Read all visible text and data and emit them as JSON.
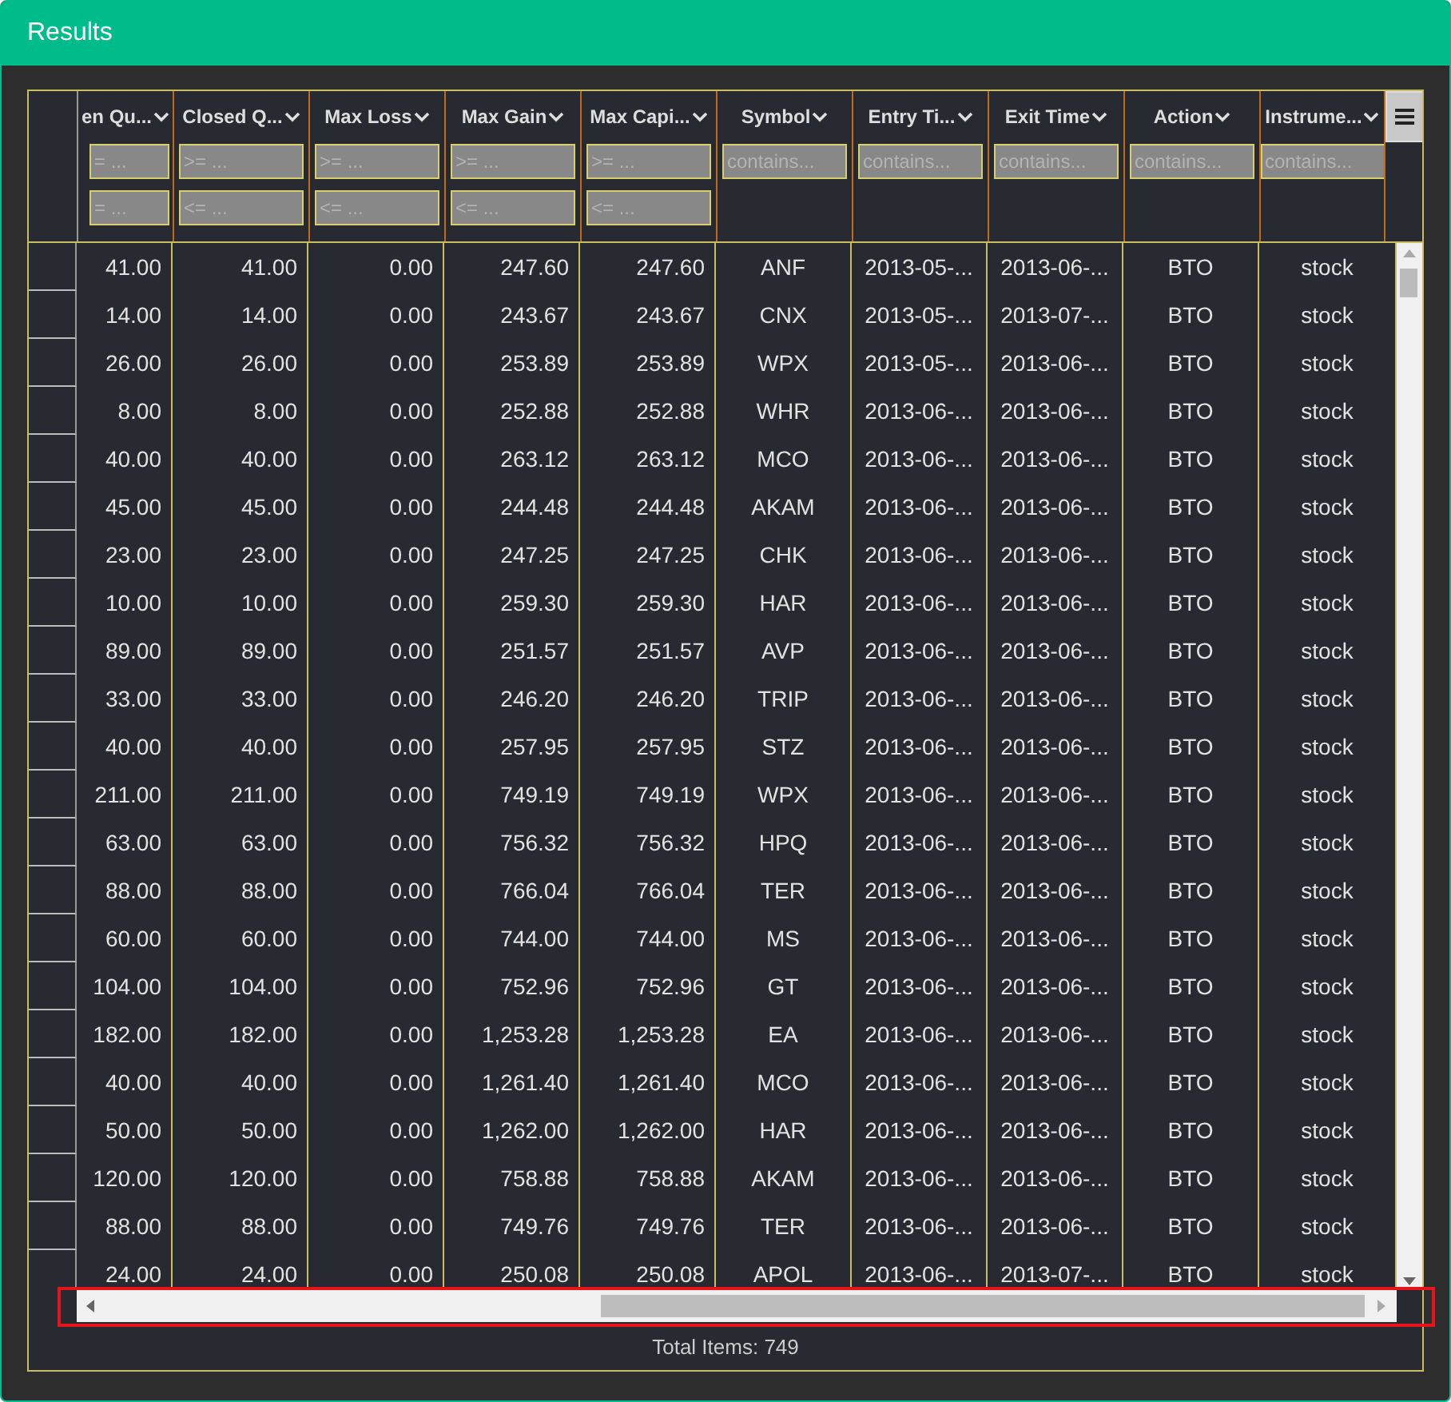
{
  "window": {
    "title": "Results"
  },
  "table": {
    "columns": [
      {
        "label": "en Qu...",
        "kind": "number",
        "placeholders": [
          "= ...",
          "= ..."
        ]
      },
      {
        "label": "Closed Q...",
        "kind": "number",
        "placeholders": [
          ">= ...",
          "<= ..."
        ]
      },
      {
        "label": "Max Loss",
        "kind": "number",
        "placeholders": [
          ">= ...",
          "<= ..."
        ]
      },
      {
        "label": "Max Gain",
        "kind": "number",
        "placeholders": [
          ">= ...",
          "<= ..."
        ]
      },
      {
        "label": "Max Capi...",
        "kind": "number",
        "placeholders": [
          ">= ...",
          "<= ..."
        ]
      },
      {
        "label": "Symbol",
        "kind": "text",
        "placeholders": [
          "contains..."
        ]
      },
      {
        "label": "Entry Ti...",
        "kind": "text",
        "placeholders": [
          "contains..."
        ]
      },
      {
        "label": "Exit Time",
        "kind": "text",
        "placeholders": [
          "contains..."
        ]
      },
      {
        "label": "Action",
        "kind": "text",
        "placeholders": [
          "contains..."
        ]
      },
      {
        "label": "Instrume...",
        "kind": "text",
        "placeholders": [
          "contains..."
        ]
      }
    ],
    "rows": [
      [
        "41.00",
        "41.00",
        "0.00",
        "247.60",
        "247.60",
        "ANF",
        "2013-05-...",
        "2013-06-...",
        "BTO",
        "stock"
      ],
      [
        "14.00",
        "14.00",
        "0.00",
        "243.67",
        "243.67",
        "CNX",
        "2013-05-...",
        "2013-07-...",
        "BTO",
        "stock"
      ],
      [
        "26.00",
        "26.00",
        "0.00",
        "253.89",
        "253.89",
        "WPX",
        "2013-05-...",
        "2013-06-...",
        "BTO",
        "stock"
      ],
      [
        "8.00",
        "8.00",
        "0.00",
        "252.88",
        "252.88",
        "WHR",
        "2013-06-...",
        "2013-06-...",
        "BTO",
        "stock"
      ],
      [
        "40.00",
        "40.00",
        "0.00",
        "263.12",
        "263.12",
        "MCO",
        "2013-06-...",
        "2013-06-...",
        "BTO",
        "stock"
      ],
      [
        "45.00",
        "45.00",
        "0.00",
        "244.48",
        "244.48",
        "AKAM",
        "2013-06-...",
        "2013-06-...",
        "BTO",
        "stock"
      ],
      [
        "23.00",
        "23.00",
        "0.00",
        "247.25",
        "247.25",
        "CHK",
        "2013-06-...",
        "2013-06-...",
        "BTO",
        "stock"
      ],
      [
        "10.00",
        "10.00",
        "0.00",
        "259.30",
        "259.30",
        "HAR",
        "2013-06-...",
        "2013-06-...",
        "BTO",
        "stock"
      ],
      [
        "89.00",
        "89.00",
        "0.00",
        "251.57",
        "251.57",
        "AVP",
        "2013-06-...",
        "2013-06-...",
        "BTO",
        "stock"
      ],
      [
        "33.00",
        "33.00",
        "0.00",
        "246.20",
        "246.20",
        "TRIP",
        "2013-06-...",
        "2013-06-...",
        "BTO",
        "stock"
      ],
      [
        "40.00",
        "40.00",
        "0.00",
        "257.95",
        "257.95",
        "STZ",
        "2013-06-...",
        "2013-06-...",
        "BTO",
        "stock"
      ],
      [
        "211.00",
        "211.00",
        "0.00",
        "749.19",
        "749.19",
        "WPX",
        "2013-06-...",
        "2013-06-...",
        "BTO",
        "stock"
      ],
      [
        "63.00",
        "63.00",
        "0.00",
        "756.32",
        "756.32",
        "HPQ",
        "2013-06-...",
        "2013-06-...",
        "BTO",
        "stock"
      ],
      [
        "88.00",
        "88.00",
        "0.00",
        "766.04",
        "766.04",
        "TER",
        "2013-06-...",
        "2013-06-...",
        "BTO",
        "stock"
      ],
      [
        "60.00",
        "60.00",
        "0.00",
        "744.00",
        "744.00",
        "MS",
        "2013-06-...",
        "2013-06-...",
        "BTO",
        "stock"
      ],
      [
        "104.00",
        "104.00",
        "0.00",
        "752.96",
        "752.96",
        "GT",
        "2013-06-...",
        "2013-06-...",
        "BTO",
        "stock"
      ],
      [
        "182.00",
        "182.00",
        "0.00",
        "1,253.28",
        "1,253.28",
        "EA",
        "2013-06-...",
        "2013-06-...",
        "BTO",
        "stock"
      ],
      [
        "40.00",
        "40.00",
        "0.00",
        "1,261.40",
        "1,261.40",
        "MCO",
        "2013-06-...",
        "2013-06-...",
        "BTO",
        "stock"
      ],
      [
        "50.00",
        "50.00",
        "0.00",
        "1,262.00",
        "1,262.00",
        "HAR",
        "2013-06-...",
        "2013-06-...",
        "BTO",
        "stock"
      ],
      [
        "120.00",
        "120.00",
        "0.00",
        "758.88",
        "758.88",
        "AKAM",
        "2013-06-...",
        "2013-06-...",
        "BTO",
        "stock"
      ],
      [
        "88.00",
        "88.00",
        "0.00",
        "749.76",
        "749.76",
        "TER",
        "2013-06-...",
        "2013-06-...",
        "BTO",
        "stock"
      ],
      [
        "24.00",
        "24.00",
        "0.00",
        "250.08",
        "250.08",
        "APOL",
        "2013-06-...",
        "2013-07-...",
        "BTO",
        "stock"
      ]
    ]
  },
  "footer": {
    "total": "Total Items: 749"
  }
}
